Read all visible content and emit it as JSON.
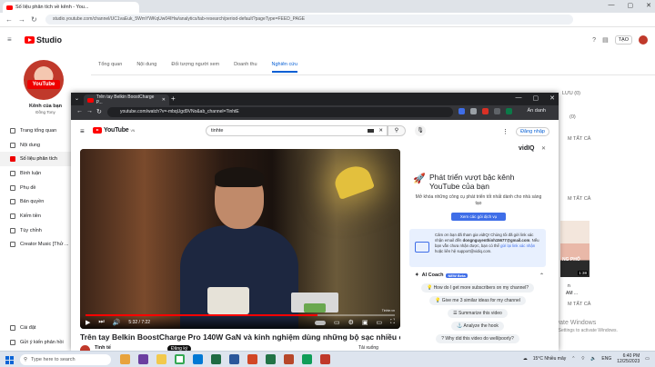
{
  "back_browser": {
    "tab_title": "Số liệu phân tích về kênh - You...",
    "url": "studio.youtube.com/channel/UC1vaEuk_5WmYWKqUw04IHw/analytics/tab-research/period-default?pageType=FEED_PAGE",
    "window_controls": [
      "—",
      "▢",
      "✕"
    ]
  },
  "studio": {
    "logo_text": "Studio",
    "create_label": "TẠO",
    "channel_badge": "YouTube",
    "channel_label": "Kênh của bạn",
    "channel_name": "Đồng Tony",
    "nav": [
      {
        "label": "Trang tổng quan",
        "active": false
      },
      {
        "label": "Nội dung",
        "active": false
      },
      {
        "label": "Số liệu phân tích",
        "active": true
      },
      {
        "label": "Bình luận",
        "active": false
      },
      {
        "label": "Phụ đề",
        "active": false
      },
      {
        "label": "Bản quyền",
        "active": false
      },
      {
        "label": "Kiếm tiền",
        "active": false
      },
      {
        "label": "Tùy chỉnh",
        "active": false
      },
      {
        "label": "Creator Music [Thử ...",
        "active": false
      }
    ],
    "nav_bottom": [
      {
        "label": "Cài đặt"
      },
      {
        "label": "Gửi ý kiến phản hồi"
      }
    ],
    "tabs": [
      {
        "label": "Tổng quan",
        "active": false
      },
      {
        "label": "Nội dung",
        "active": false
      },
      {
        "label": "Đối tượng người xem",
        "active": false
      },
      {
        "label": "Doanh thu",
        "active": false
      },
      {
        "label": "Nghiên cứu",
        "active": true
      }
    ],
    "right_fragments": [
      "LƯU (0)",
      "(0)",
      "M TẤT CẢ",
      "M TẤT CẢ",
      "M TẤT CẢ"
    ],
    "thumb_duration": "1:38",
    "thumb_texts": [
      "NG PHỐ",
      "n",
      "AM ..."
    ]
  },
  "windows_watermark": {
    "line1": "Activate Windows",
    "line2": "Go to Settings to activate Windows."
  },
  "popup": {
    "tab_title": "Trên tay Belkin BoostCharge P...",
    "url": "youtube.com/watch?v=-mbqUgd9VNo&ab_channel=TinhtE",
    "hide_label": "Ẩn danh",
    "search_value": "tinhte",
    "signin_label": "Đăng nhập",
    "video": {
      "time": "5:32 / 7:22",
      "progress": 0.75,
      "watermark": "Tinhte.vn"
    },
    "video_title": "Trên tay Belkin BoostCharge Pro 140W GaN và kinh nghiệm dùng những bộ sạc nhiều cổng",
    "owner_name": "Tinh tế",
    "subscribe_label": "Đăng ký",
    "download_label": "Tải xuống"
  },
  "vidiq": {
    "logo": "vidIQ",
    "headline": "Phát triển vượt bậc kênh YouTube của bạn",
    "paragraph": "Mở khóa những công cụ phát triển tốt nhất dành cho nhà sáng tạo",
    "cta": "Xem các gói dịch vụ",
    "notice_a": "Cảm ơn bạn đã tham gia vidIQ! Chúng tôi đã gửi link xác nhận email đến",
    "notice_email": "dongnguyenthinh15677@gmail.com",
    "notice_b": ". Nếu bạn vẫn chưa nhận được, bạn có thể",
    "notice_link": "gửi lại link xác nhận",
    "notice_c": "hoặc liên hệ support@vidiq.com.",
    "ai_label": "AI Coach",
    "beta_label": "NEW Beta",
    "chips": [
      "How do I get more subscribers on my channel?",
      "Give me 3 similar ideas for my channel",
      "Summarize this video",
      "Analyze the hook",
      "Why did this video do well/poorly?"
    ]
  },
  "taskbar": {
    "search_placeholder": "Type here to search",
    "weather": "15°C Nhiều mây",
    "lang": "ENG",
    "time": "6:40 PM",
    "date": "12/25/2023"
  },
  "colors": {
    "brand_red": "#ff0000",
    "studio_accent": "#065fd4",
    "vidiq_green": "#0b7a48",
    "vidiq_blue": "#3f6ee8"
  }
}
